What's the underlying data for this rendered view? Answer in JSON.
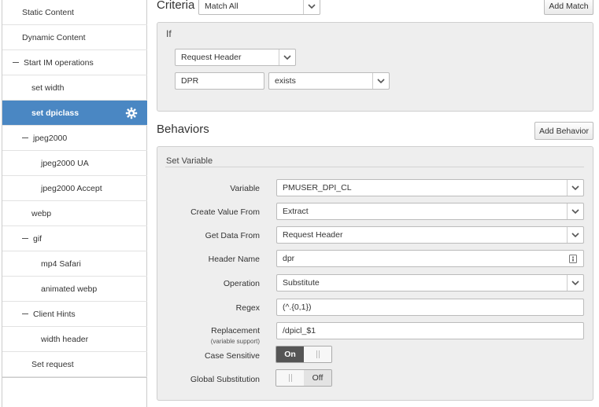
{
  "sidebar": {
    "items": [
      {
        "label": "Static Content",
        "indent": 0,
        "collapsible": false,
        "active": false
      },
      {
        "label": "Dynamic Content",
        "indent": 0,
        "collapsible": false,
        "active": false
      },
      {
        "label": "Start IM operations",
        "indent": 0,
        "collapsible": true,
        "active": false
      },
      {
        "label": "set width",
        "indent": 1,
        "collapsible": false,
        "active": false
      },
      {
        "label": "set dpiclass",
        "indent": 1,
        "collapsible": false,
        "active": true
      },
      {
        "label": "jpeg2000",
        "indent": 1,
        "collapsible": true,
        "active": false
      },
      {
        "label": "jpeg2000 UA",
        "indent": 2,
        "collapsible": false,
        "active": false
      },
      {
        "label": "jpeg2000 Accept",
        "indent": 2,
        "collapsible": false,
        "active": false
      },
      {
        "label": "webp",
        "indent": 1,
        "collapsible": false,
        "active": false
      },
      {
        "label": "gif",
        "indent": 1,
        "collapsible": true,
        "active": false
      },
      {
        "label": "mp4 Safari",
        "indent": 2,
        "collapsible": false,
        "active": false
      },
      {
        "label": "animated webp",
        "indent": 2,
        "collapsible": false,
        "active": false
      },
      {
        "label": "Client Hints",
        "indent": 1,
        "collapsible": true,
        "active": false
      },
      {
        "label": "width header",
        "indent": 2,
        "collapsible": false,
        "active": false
      },
      {
        "label": "Set request",
        "indent": 1,
        "collapsible": false,
        "active": false
      }
    ]
  },
  "criteria": {
    "title": "Criteria",
    "match_select": "Match All",
    "add_match_label": "Add Match",
    "if_label": "If",
    "condition_select": "Request Header",
    "header_name_value": "DPR",
    "operator_select": "exists"
  },
  "behaviors": {
    "title": "Behaviors",
    "add_behavior_label": "Add Behavior",
    "panel_title": "Set Variable",
    "variable_label": "Variable",
    "variable_value": "PMUSER_DPI_CL",
    "create_value_from_label": "Create Value From",
    "create_value_from_value": "Extract",
    "get_data_from_label": "Get Data From",
    "get_data_from_value": "Request Header",
    "header_name_label": "Header Name",
    "header_name_value": "dpr",
    "operation_label": "Operation",
    "operation_value": "Substitute",
    "regex_label": "Regex",
    "regex_value": "(^.{0,1})",
    "replacement_label": "Replacement",
    "replacement_sublabel": "(variable support)",
    "replacement_value": "/dpicl_$1",
    "case_sensitive_label": "Case Sensitive",
    "case_sensitive_on_text": "On",
    "case_sensitive_state": "on",
    "global_substitution_label": "Global Substitution",
    "global_substitution_off_text": "Off",
    "global_substitution_state": "off"
  },
  "colors": {
    "active_item_bg": "#4a87c3",
    "panel_bg": "#eeeeee",
    "toggle_on_bg": "#555555"
  }
}
